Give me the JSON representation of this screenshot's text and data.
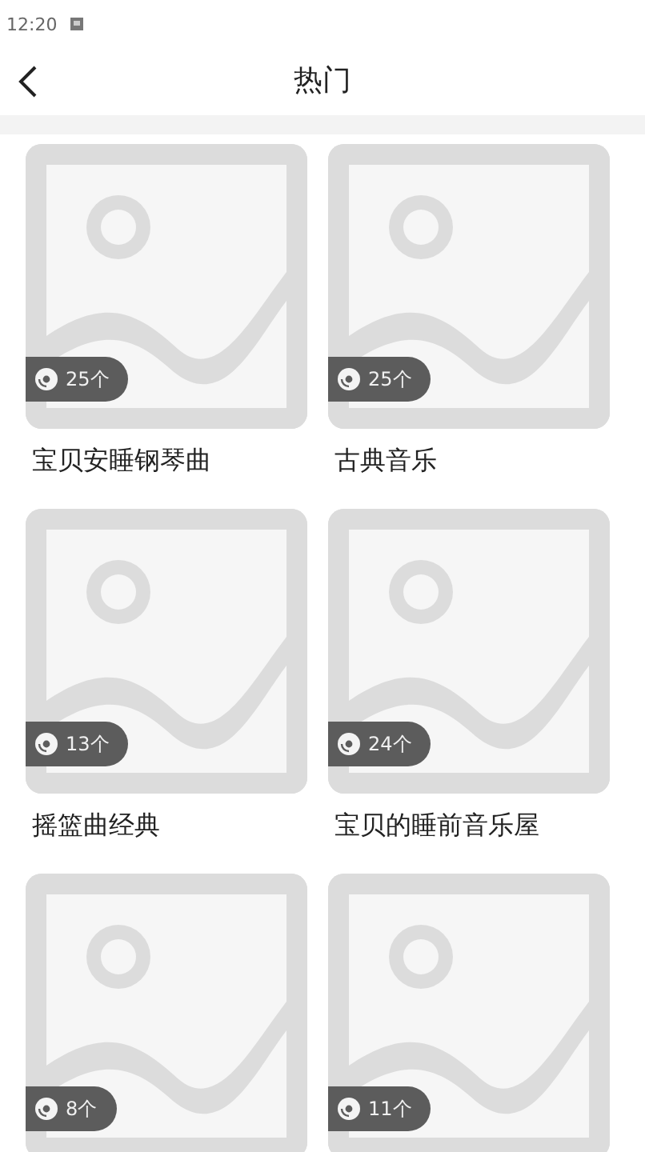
{
  "status_bar": {
    "time": "12:20"
  },
  "header": {
    "title": "热门"
  },
  "playlists": [
    {
      "count": "25个",
      "title": "宝贝安睡钢琴曲"
    },
    {
      "count": "25个",
      "title": "古典音乐"
    },
    {
      "count": "13个",
      "title": "摇篮曲经典"
    },
    {
      "count": "24个",
      "title": "宝贝的睡前音乐屋"
    },
    {
      "count": "8个"
    },
    {
      "count": "11个"
    }
  ]
}
